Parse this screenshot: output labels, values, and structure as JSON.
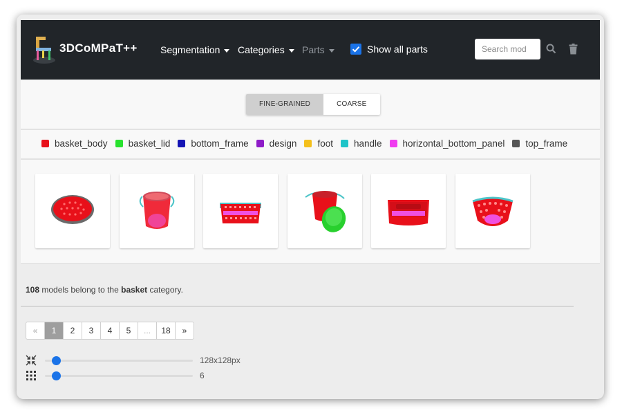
{
  "colors": {
    "navbar_bg": "#212529",
    "accent": "#1a73e8",
    "basket_body": "#e8101a",
    "basket_lid": "#28e22e",
    "bottom_frame": "#1414b4",
    "design": "#8e1cc8",
    "foot": "#f4c01c",
    "handle": "#1ec4c8",
    "horizontal_bottom_panel": "#f03cf0",
    "top_frame": "#555555"
  },
  "navbar": {
    "brand": "3DCoMPaT++",
    "logo_icon": "chair-logo-icon",
    "menu": [
      {
        "label": "Segmentation",
        "icon": "caret-down-icon"
      },
      {
        "label": "Categories",
        "icon": "caret-down-icon"
      },
      {
        "label": "Parts",
        "icon": "caret-down-icon",
        "disabled": true
      }
    ],
    "show_all_parts": {
      "label": "Show all parts",
      "checked": true
    },
    "search": {
      "placeholder": "Search mod",
      "value": ""
    },
    "search_icon": "search-icon",
    "delete_icon": "trash-icon"
  },
  "segmentation_mode": {
    "options": [
      "FINE-GRAINED",
      "COARSE"
    ],
    "selected": "FINE-GRAINED"
  },
  "legend": [
    {
      "label": "basket_body",
      "color": "#e8101a"
    },
    {
      "label": "basket_lid",
      "color": "#28e22e"
    },
    {
      "label": "bottom_frame",
      "color": "#1414b4"
    },
    {
      "label": "design",
      "color": "#8e1cc8"
    },
    {
      "label": "foot",
      "color": "#f4c01c"
    },
    {
      "label": "handle",
      "color": "#1ec4c8"
    },
    {
      "label": "horizontal_bottom_panel",
      "color": "#f03cf0"
    },
    {
      "label": "top_frame",
      "color": "#555555"
    }
  ],
  "thumbnails": [
    {
      "name": "round-flat-basket"
    },
    {
      "name": "bucket-basket-with-handles"
    },
    {
      "name": "rectangular-perforated-basket"
    },
    {
      "name": "bucket-with-green-lid"
    },
    {
      "name": "rectangular-tray-basket"
    },
    {
      "name": "round-perforated-basket"
    }
  ],
  "info": {
    "count": "108",
    "text_middle": " models belong to the ",
    "category": "basket",
    "text_end": " category."
  },
  "pagination": {
    "prev": "«",
    "pages": [
      "1",
      "2",
      "3",
      "4",
      "5",
      "...",
      "18"
    ],
    "active": "1",
    "next": "»"
  },
  "sliders": {
    "size": {
      "icon": "shrink-arrows-icon",
      "value_label": "128x128px",
      "level": 0.05
    },
    "grid": {
      "icon": "grid-dots-icon",
      "value_label": "6",
      "level": 0.05
    }
  }
}
